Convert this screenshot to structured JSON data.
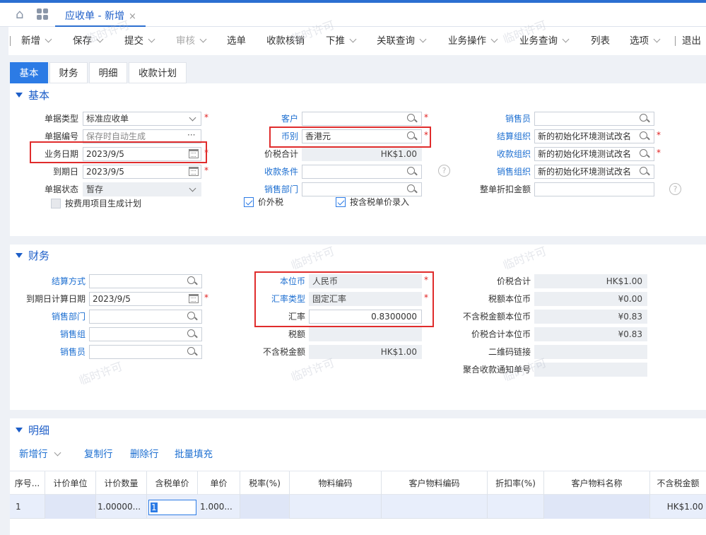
{
  "header": {
    "doc_tab": "应收单 - 新增",
    "close_glyph": "×"
  },
  "toolbar": {
    "items": [
      "新增",
      "保存",
      "提交",
      "审核",
      "选单",
      "收款核销",
      "下推",
      "关联查询",
      "业务操作",
      "业务查询",
      "列表",
      "选项",
      "退出"
    ]
  },
  "page_tabs": [
    "基本",
    "财务",
    "明细",
    "收款计划"
  ],
  "basic": {
    "title": "基本",
    "bill_type": {
      "label": "单据类型",
      "value": "标准应收单"
    },
    "bill_no": {
      "label": "单据编号",
      "value": "保存时自动生成"
    },
    "biz_date": {
      "label": "业务日期",
      "value": "2023/9/5"
    },
    "due_date": {
      "label": "到期日",
      "value": "2023/9/5"
    },
    "bill_status": {
      "label": "单据状态",
      "value": "暂存"
    },
    "gen_plan": {
      "label": "按费用项目生成计划"
    },
    "customer": {
      "label": "客户",
      "value": ""
    },
    "currency": {
      "label": "币别",
      "value": "香港元"
    },
    "total_tax": {
      "label": "价税合计",
      "value": "HK$1.00"
    },
    "pay_terms": {
      "label": "收款条件",
      "value": ""
    },
    "sales_dept": {
      "label": "销售部门",
      "value": ""
    },
    "price_excl_tax": {
      "label": "价外税"
    },
    "tax_price_entry": {
      "label": "按含税单价录入"
    },
    "salesman": {
      "label": "销售员",
      "value": ""
    },
    "settle_org": {
      "label": "结算组织",
      "value": "新的初始化环境测试改名"
    },
    "receive_org": {
      "label": "收款组织",
      "value": "新的初始化环境测试改名"
    },
    "sales_org": {
      "label": "销售组织",
      "value": "新的初始化环境测试改名"
    },
    "whole_discount": {
      "label": "整单折扣金额",
      "value": ""
    }
  },
  "finance": {
    "title": "财务",
    "settle_method": {
      "label": "结算方式",
      "value": ""
    },
    "due_calc_date": {
      "label": "到期日计算日期",
      "value": "2023/9/5"
    },
    "sales_dept": {
      "label": "销售部门",
      "value": ""
    },
    "sales_group": {
      "label": "销售组",
      "value": ""
    },
    "salesman": {
      "label": "销售员",
      "value": ""
    },
    "base_currency": {
      "label": "本位币",
      "value": "人民币"
    },
    "rate_type": {
      "label": "汇率类型",
      "value": "固定汇率"
    },
    "exchange_rate": {
      "label": "汇率",
      "value": "0.8300000"
    },
    "tax_amount": {
      "label": "税额",
      "value": ""
    },
    "amount_excl_tax": {
      "label": "不含税金额",
      "value": "HK$1.00"
    },
    "total_tax": {
      "label": "价税合计",
      "value": "HK$1.00"
    },
    "tax_base": {
      "label": "税额本位币",
      "value": "¥0.00"
    },
    "excl_tax_base": {
      "label": "不含税金额本位币",
      "value": "¥0.83"
    },
    "total_tax_base": {
      "label": "价税合计本位币",
      "value": "¥0.83"
    },
    "qr_link": {
      "label": "二维码链接",
      "value": ""
    },
    "agg_notice_no": {
      "label": "聚合收款通知单号",
      "value": ""
    }
  },
  "detail": {
    "title": "明细",
    "actions": [
      "新增行",
      "复制行",
      "删除行",
      "批量填充"
    ],
    "columns": [
      "序号...",
      "计价单位",
      "计价数量",
      "含税单价",
      "单价",
      "税率(%)",
      "物料编码",
      "客户物料编码",
      "折扣率(%)",
      "客户物料名称",
      "不含税金额"
    ],
    "rows": [
      [
        "1",
        "",
        "1.00000...",
        "1",
        "1.000...",
        "",
        "",
        "",
        "",
        "",
        "HK$1.00"
      ]
    ]
  },
  "watermark": "临时许可",
  "colors": {
    "accent": "#2c7be5",
    "link": "#1d6fd1",
    "required": "#e02020",
    "highlight_box": "#e02c2c"
  }
}
